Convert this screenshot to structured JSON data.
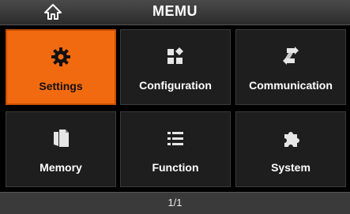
{
  "header": {
    "title": "MEMU",
    "home_icon": "home-icon"
  },
  "tiles": [
    {
      "label": "Settings",
      "icon": "gear-icon",
      "selected": true
    },
    {
      "label": "Configuration",
      "icon": "config-blocks-icon",
      "selected": false
    },
    {
      "label": "Communication",
      "icon": "exchange-icon",
      "selected": false
    },
    {
      "label": "Memory",
      "icon": "documents-icon",
      "selected": false
    },
    {
      "label": "Function",
      "icon": "list-icon",
      "selected": false
    },
    {
      "label": "System",
      "icon": "puzzle-icon",
      "selected": false
    }
  ],
  "footer": {
    "page": "1/1"
  },
  "colors": {
    "accent": "#f26a10",
    "tile_bg": "#1e1e1e",
    "header_bg": "#3a3a3a"
  }
}
